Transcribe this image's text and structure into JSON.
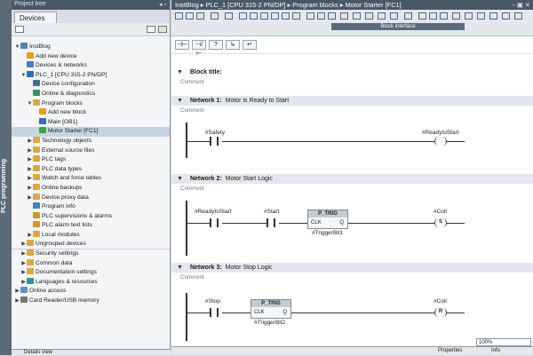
{
  "left_panel": {
    "title": "Project tree",
    "tab": "Devices",
    "side_tab": "PLC programming",
    "tree": [
      {
        "label": "InstBlog",
        "indent": 0,
        "arrow": "▼",
        "icon": "project"
      },
      {
        "label": "Add new device",
        "indent": 1,
        "arrow": "",
        "icon": "add"
      },
      {
        "label": "Devices & networks",
        "indent": 1,
        "arrow": "",
        "icon": "network"
      },
      {
        "label": "PLC_1 [CPU 315-2 PN/DP]",
        "indent": 1,
        "arrow": "▼",
        "icon": "plc"
      },
      {
        "label": "Device configuration",
        "indent": 2,
        "arrow": "",
        "icon": "config"
      },
      {
        "label": "Online & diagnostics",
        "indent": 2,
        "arrow": "",
        "icon": "diag"
      },
      {
        "label": "Program blocks",
        "indent": 2,
        "arrow": "▼",
        "icon": "folder"
      },
      {
        "label": "Add new block",
        "indent": 3,
        "arrow": "",
        "icon": "add"
      },
      {
        "label": "Main [OB1]",
        "indent": 3,
        "arrow": "",
        "icon": "block"
      },
      {
        "label": "Motor Starter [FC1]",
        "indent": 3,
        "arrow": "",
        "icon": "blockfc",
        "selected": true
      },
      {
        "label": "Technology objects",
        "indent": 2,
        "arrow": "▶",
        "icon": "folder"
      },
      {
        "label": "External source files",
        "indent": 2,
        "arrow": "▶",
        "icon": "folder"
      },
      {
        "label": "PLC tags",
        "indent": 2,
        "arrow": "▶",
        "icon": "folder"
      },
      {
        "label": "PLC data types",
        "indent": 2,
        "arrow": "▶",
        "icon": "folder"
      },
      {
        "label": "Watch and force tables",
        "indent": 2,
        "arrow": "▶",
        "icon": "folder"
      },
      {
        "label": "Online backups",
        "indent": 2,
        "arrow": "▶",
        "icon": "folder"
      },
      {
        "label": "Device proxy data",
        "indent": 2,
        "arrow": "▶",
        "icon": "folder"
      },
      {
        "label": "Program info",
        "indent": 2,
        "arrow": "",
        "icon": "info"
      },
      {
        "label": "PLC supervisions & alarms",
        "indent": 2,
        "arrow": "",
        "icon": "alarm"
      },
      {
        "label": "PLC alarm text lists",
        "indent": 2,
        "arrow": "",
        "icon": "alarm"
      },
      {
        "label": "Local modules",
        "indent": 2,
        "arrow": "▶",
        "icon": "folder"
      },
      {
        "label": "Ungrouped devices",
        "indent": 1,
        "arrow": "▶",
        "icon": "folder",
        "sep": true
      },
      {
        "label": "Security settings",
        "indent": 1,
        "arrow": "▶",
        "icon": "folder"
      },
      {
        "label": "Common data",
        "indent": 1,
        "arrow": "▶",
        "icon": "folder"
      },
      {
        "label": "Documentation settings",
        "indent": 1,
        "arrow": "▶",
        "icon": "folder"
      },
      {
        "label": "Languages & resources",
        "indent": 1,
        "arrow": "▶",
        "icon": "lang"
      },
      {
        "label": "Online access",
        "indent": 0,
        "arrow": "▶",
        "icon": "online"
      },
      {
        "label": "Card Reader/USB memory",
        "indent": 0,
        "arrow": "▶",
        "icon": "card"
      }
    ],
    "details_view": "Details view"
  },
  "breadcrumb": {
    "text": "InstBlog ▸ PLC_1 [CPU 315-2 PN/DP] ▸ Program blocks ▸ Motor Starter [FC1]"
  },
  "editor": {
    "block_interface_label": "Block interface",
    "block_title": "Block title:",
    "comment": "Comment",
    "networks": [
      {
        "number": "Network 1:",
        "title": "Motor is Ready to Start"
      },
      {
        "number": "Network 2:",
        "title": "Motor Start Logic"
      },
      {
        "number": "Network 3:",
        "title": "Motor Stop Logic"
      }
    ],
    "net1": {
      "contact": "#Safety",
      "coil": "#ReadytoStart"
    },
    "net2": {
      "contact1": "#ReadytoStart",
      "contact2": "#Start",
      "block": "P_TRIG",
      "clk": "CLK",
      "q": "Q",
      "instance": "#TriggerBit1",
      "coil": "#Coil",
      "coil_type": "S"
    },
    "net3": {
      "contact": "#Stop",
      "block": "P_TRIG",
      "clk": "CLK",
      "q": "Q",
      "instance": "#TriggerBit2",
      "coil": "#Coil",
      "coil_type": "R"
    },
    "zoom": "100%"
  },
  "status": {
    "properties": "Properties",
    "info": "Info"
  },
  "colors": {
    "accent": "#4a5866",
    "selection": "#c6d4e2"
  }
}
